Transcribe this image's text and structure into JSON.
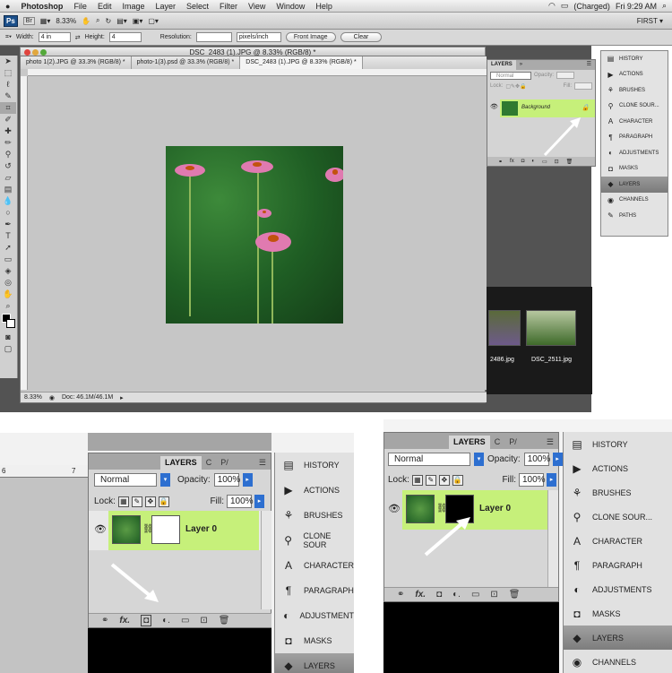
{
  "menubar": {
    "app": "Photoshop",
    "items": [
      "File",
      "Edit",
      "Image",
      "Layer",
      "Select",
      "Filter",
      "View",
      "Window",
      "Help"
    ],
    "battery": "(Charged)",
    "clock": "Fri 9:29 AM"
  },
  "appbar": {
    "ps": "Ps",
    "br": "Br",
    "zoom": "8.33%",
    "workspace": "FIRST ▾"
  },
  "options": {
    "width_label": "Width:",
    "width_value": "4 in",
    "height_label": "Height:",
    "height_value": "4",
    "resolution_label": "Resolution:",
    "resolution_unit": "pixels/inch",
    "front_image": "Front Image",
    "clear": "Clear"
  },
  "doc": {
    "title": "DSC_2483 (1).JPG @ 8.33% (RGB/8) *",
    "tabs": [
      "photo 1(2).JPG @ 33.3% (RGB/8) *",
      "photo-1(3).psd @ 33.3% (RGB/8) *",
      "DSC_2483 (1).JPG @ 8.33% (RGB/8) *"
    ],
    "zoom": "8.33%",
    "docsize": "Doc: 46.1M/46.1M"
  },
  "small_layers": {
    "tabs": [
      "LAYERS",
      "»"
    ],
    "blend": "Normal",
    "opacity_label": "Opacity:",
    "lock_label": "Lock:",
    "fill_label": "Fill:",
    "layer_name": "Background"
  },
  "mini_panel": {
    "items": [
      "HISTORY",
      "ACTIONS",
      "BRUSHES",
      "CLONE SOUR...",
      "CHARACTER",
      "PARAGRAPH",
      "ADJUSTMENTS",
      "MASKS",
      "LAYERS",
      "CHANNELS",
      "PATHS"
    ]
  },
  "browser": {
    "files": [
      "2486.jpg",
      "DSC_2511.jpg"
    ]
  },
  "bottom_left": {
    "tabs": [
      "LAYERS",
      "C",
      "P/"
    ],
    "blend": "Normal",
    "opacity_label": "Opacity:",
    "opacity": "100%",
    "lock_label": "Lock:",
    "fill_label": "Fill:",
    "fill": "100%",
    "layer_name": "Layer 0",
    "panel_items": [
      "HISTORY",
      "ACTIONS",
      "BRUSHES",
      "CLONE SOUR",
      "CHARACTER",
      "PARAGRAPH",
      "ADJUSTMENT",
      "MASKS",
      "LAYERS"
    ]
  },
  "bottom_right": {
    "tabs": [
      "LAYERS",
      "C",
      "P/"
    ],
    "blend": "Normal",
    "opacity_label": "Opacity:",
    "opacity": "100%",
    "lock_label": "Lock:",
    "fill_label": "Fill:",
    "fill": "100%",
    "layer_name": "Layer 0",
    "panel_items": [
      "HISTORY",
      "ACTIONS",
      "BRUSHES",
      "CLONE SOUR...",
      "CHARACTER",
      "PARAGRAPH",
      "ADJUSTMENTS",
      "MASKS",
      "LAYERS",
      "CHANNELS"
    ]
  },
  "ruler": {
    "r6": "6",
    "r7": "7"
  }
}
